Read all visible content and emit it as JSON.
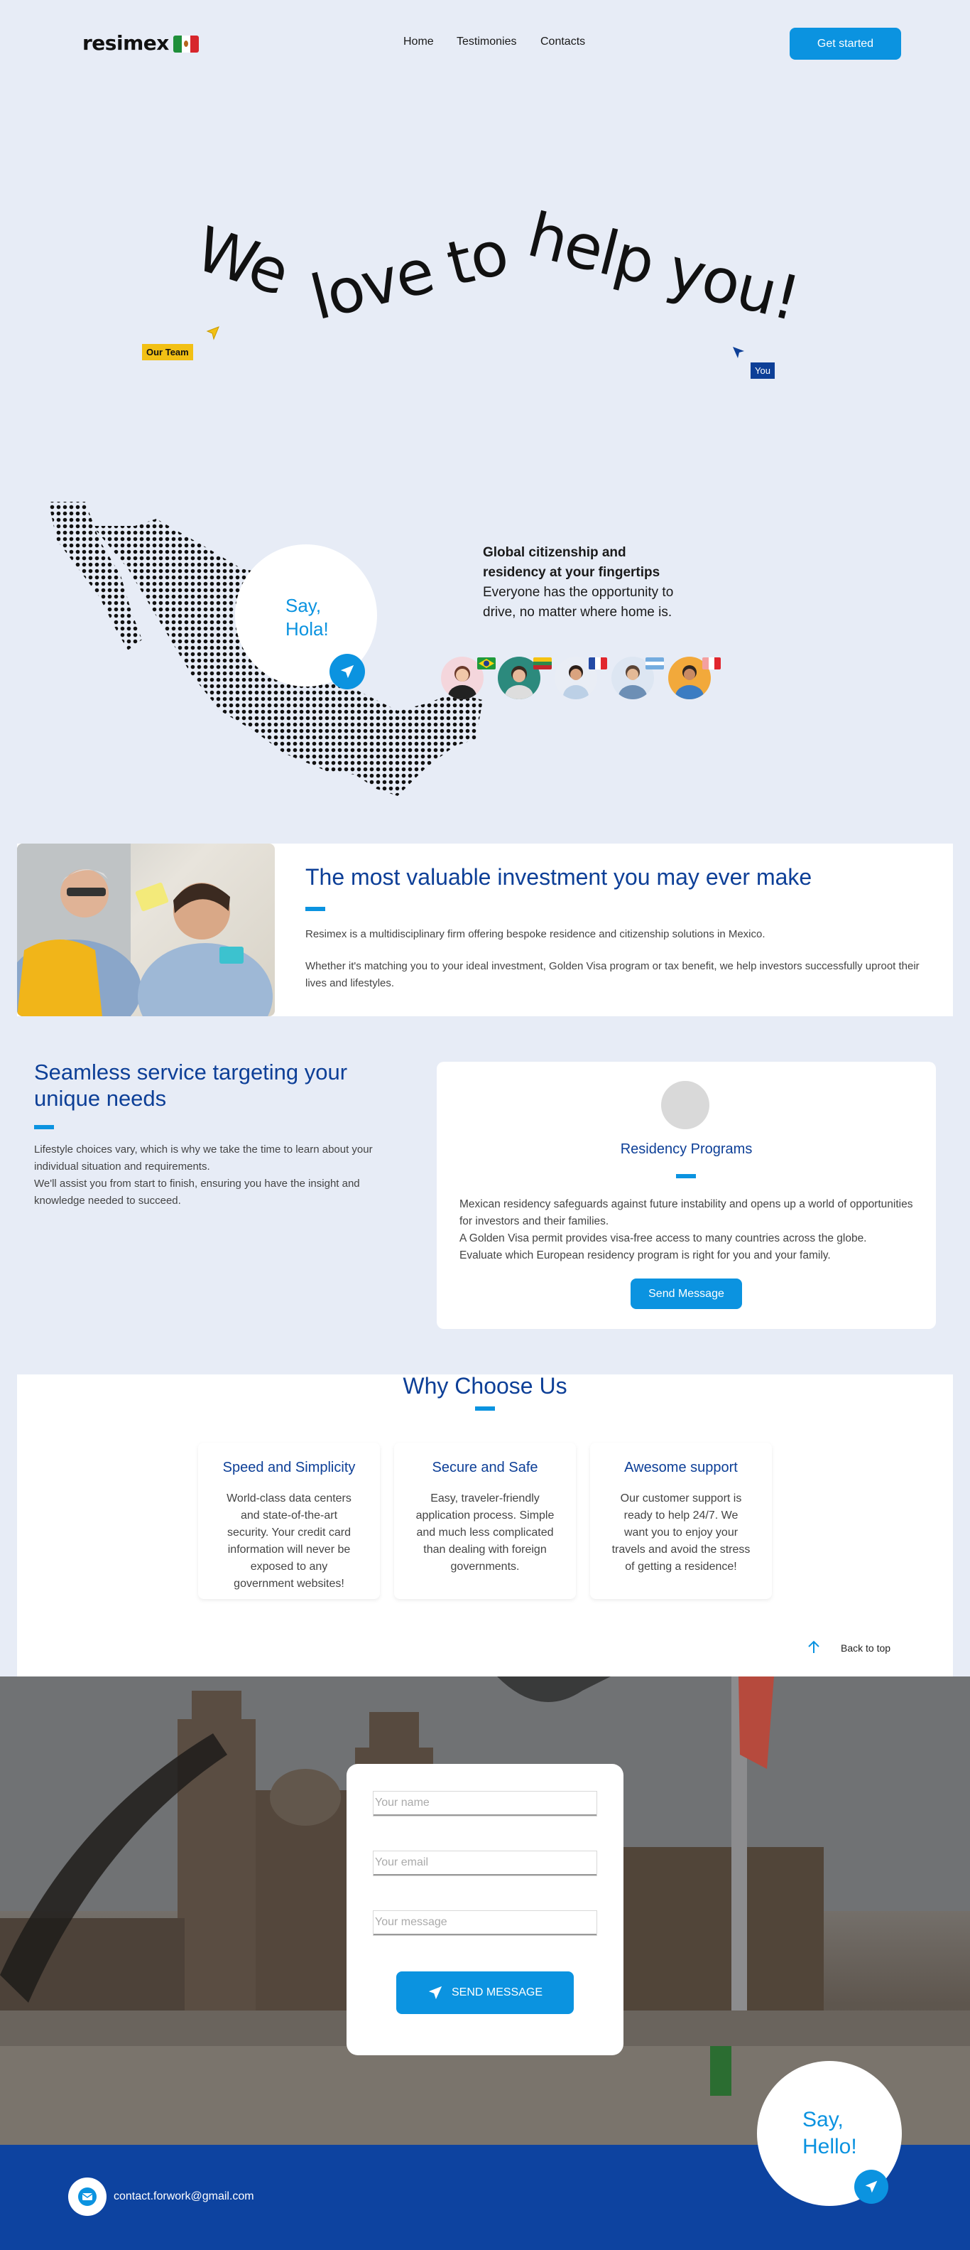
{
  "header": {
    "logo": "resimex",
    "nav": [
      "Home",
      "Testimonies",
      "Contacts"
    ],
    "cta_label": "Get started"
  },
  "hero": {
    "words": [
      "We",
      "love to",
      "help you!"
    ],
    "tag_team": "Our Team",
    "tag_you": "You"
  },
  "global": {
    "say_line1": "Say,",
    "say_line2": "Hola!",
    "title": "Global citizenship and residency at your fingertips",
    "subtitle": "Everyone has the opportunity to drive, no matter where home is."
  },
  "invest": {
    "title": "The most valuable investment you may ever make",
    "p1": "Resimex is a multidisciplinary firm offering bespoke residence and citizenship solutions in Mexico.",
    "p2": "Whether it's matching you to your ideal investment, Golden Visa program or tax benefit, we help investors successfully uproot their lives and lifestyles."
  },
  "seamless": {
    "title": "Seamless service targeting your unique needs",
    "p1": "Lifestyle choices vary, which is why we take the time to learn about your individual situation and requirements.",
    "p2": "We'll assist you from start to finish, ensuring you have the insight and knowledge needed to succeed."
  },
  "programs": {
    "title": "Residency Programs",
    "p1": "Mexican residency safeguards against future instability and opens up a world of opportunities for investors and their families.",
    "p2": "A Golden Visa permit provides visa-free access to many countries across the globe.",
    "p3": "Evaluate which European residency program is right for you and your family.",
    "button": "Send Message"
  },
  "why": {
    "title": "Why Choose Us",
    "cards": [
      {
        "title": "Speed and Simplicity",
        "text": "World-class data centers and state-of-the-art security. Your credit card information will never be exposed to any government websites!"
      },
      {
        "title": "Secure and Safe",
        "text": "Easy, traveler-friendly application process. Simple and much less complicated than dealing with foreign governments."
      },
      {
        "title": "Awesome support",
        "text": "Our customer support is ready to help 24/7. We want you to enjoy your travels and avoid the stress of getting a residence!"
      }
    ],
    "back_to_top": "Back to top"
  },
  "contact_form": {
    "name_placeholder": "Your name",
    "email_placeholder": "Your email",
    "message_placeholder": "Your message",
    "submit": "SEND MESSAGE",
    "say_line1": "Say,",
    "say_line2": "Hello!"
  },
  "footer": {
    "email": "contact.forwork@gmail.com"
  },
  "colors": {
    "accent": "#0b93e0",
    "brand_dark": "#0d3f97",
    "page_bg": "#e7ecf6",
    "footer_bg": "#0d43a0"
  }
}
